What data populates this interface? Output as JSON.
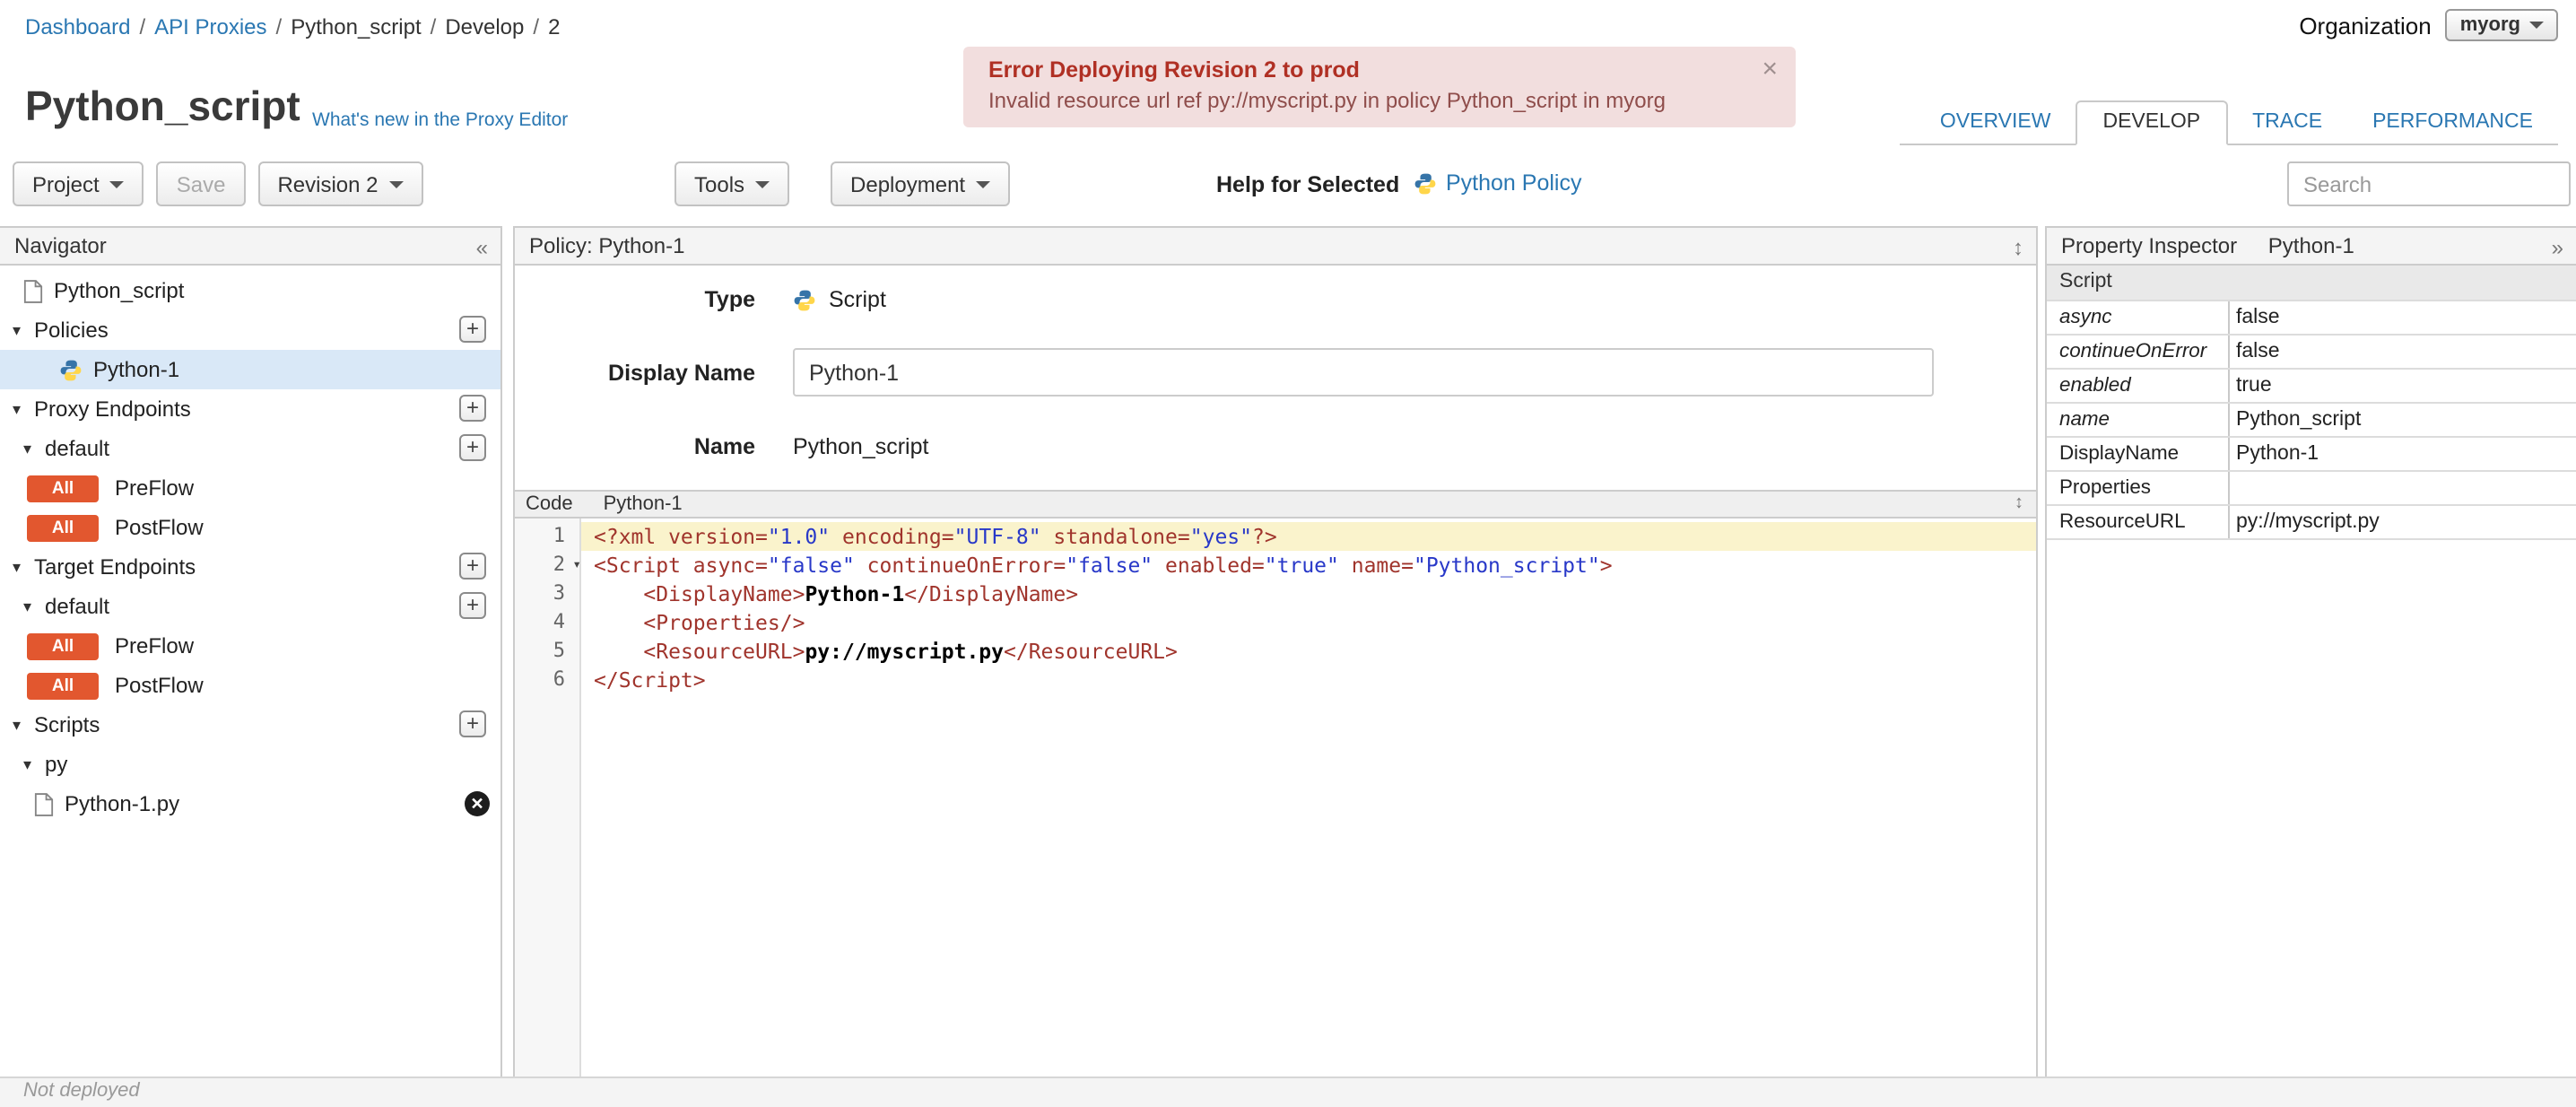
{
  "page": {
    "breadcrumb": [
      {
        "label": "Dashboard",
        "link": true
      },
      {
        "label": "API Proxies",
        "link": true
      },
      {
        "label": "Python_script",
        "link": false
      },
      {
        "label": "Develop",
        "link": false
      },
      {
        "label": "2",
        "link": false
      }
    ],
    "organization": {
      "label": "Organization",
      "value": "myorg"
    },
    "error_banner": {
      "title": "Error Deploying Revision 2 to prod",
      "message": "Invalid resource url ref py://myscript.py in policy Python_script in myorg",
      "close_label": "×"
    },
    "title": "Python_script",
    "whats_new_link": "What's new in the Proxy Editor",
    "tabs": [
      {
        "label": "OVERVIEW",
        "active": false
      },
      {
        "label": "DEVELOP",
        "active": true
      },
      {
        "label": "TRACE",
        "active": false
      },
      {
        "label": "PERFORMANCE",
        "active": false
      }
    ],
    "toolbar": {
      "project_button": "Project",
      "save_button": "Save",
      "revision_button": "Revision 2",
      "tools_button": "Tools",
      "deployment_button": "Deployment",
      "help_for_selected": "Help for Selected",
      "policy_help_link": "Python Policy",
      "search_placeholder": "Search"
    },
    "status_bar": "Not deployed"
  },
  "navigator": {
    "title": "Navigator",
    "items": [
      {
        "kind": "root",
        "icon": "file",
        "label": "Python_script"
      },
      {
        "kind": "section",
        "label": "Policies",
        "plus": true
      },
      {
        "kind": "policy",
        "icon": "python",
        "label": "Python-1",
        "selected": true
      },
      {
        "kind": "section",
        "label": "Proxy Endpoints",
        "plus": true
      },
      {
        "kind": "subsection",
        "label": "default",
        "plus": true
      },
      {
        "kind": "flow",
        "badge": "All",
        "label": "PreFlow"
      },
      {
        "kind": "flow",
        "badge": "All",
        "label": "PostFlow"
      },
      {
        "kind": "section",
        "label": "Target Endpoints",
        "plus": true
      },
      {
        "kind": "subsection",
        "label": "default",
        "plus": true
      },
      {
        "kind": "flow",
        "badge": "All",
        "label": "PreFlow"
      },
      {
        "kind": "flow",
        "badge": "All",
        "label": "PostFlow"
      },
      {
        "kind": "section",
        "label": "Scripts",
        "plus": true
      },
      {
        "kind": "subsection",
        "label": "py"
      },
      {
        "kind": "scriptfile",
        "icon": "file",
        "label": "Python-1.py",
        "deletable": true
      }
    ]
  },
  "policy_panel": {
    "header": "Policy: Python-1",
    "type_label": "Type",
    "type_value": "Script",
    "display_name_label": "Display Name",
    "display_name_value": "Python-1",
    "name_label": "Name",
    "name_value": "Python_script"
  },
  "code_panel": {
    "header_label": "Code",
    "header_value": "Python-1",
    "lines": [
      {
        "n": 1,
        "highlight": true,
        "tokens": [
          [
            "tag",
            "<?xml version="
          ],
          [
            "str",
            "\"1.0\""
          ],
          [
            "tag",
            " encoding="
          ],
          [
            "str",
            "\"UTF-8\""
          ],
          [
            "tag",
            " standalone="
          ],
          [
            "str",
            "\"yes\""
          ],
          [
            "tag",
            "?>"
          ]
        ]
      },
      {
        "n": 2,
        "fold": true,
        "tokens": [
          [
            "tag",
            "<Script async="
          ],
          [
            "str",
            "\"false\""
          ],
          [
            "tag",
            " continueOnError="
          ],
          [
            "str",
            "\"false\""
          ],
          [
            "tag",
            " enabled="
          ],
          [
            "str",
            "\"true\""
          ],
          [
            "tag",
            " name="
          ],
          [
            "str",
            "\"Python_script\""
          ],
          [
            "tag",
            ">"
          ]
        ]
      },
      {
        "n": 3,
        "tokens": [
          [
            "plain",
            "    "
          ],
          [
            "tag",
            "<DisplayName>"
          ],
          [
            "text",
            "Python-1"
          ],
          [
            "tag",
            "</DisplayName>"
          ]
        ]
      },
      {
        "n": 4,
        "tokens": [
          [
            "plain",
            "    "
          ],
          [
            "tag",
            "<Properties/>"
          ]
        ]
      },
      {
        "n": 5,
        "tokens": [
          [
            "plain",
            "    "
          ],
          [
            "tag",
            "<ResourceURL>"
          ],
          [
            "text",
            "py://myscript.py"
          ],
          [
            "tag",
            "</ResourceURL>"
          ]
        ]
      },
      {
        "n": 6,
        "tokens": [
          [
            "tag",
            "</Script>"
          ]
        ]
      }
    ]
  },
  "property_inspector": {
    "title": "Property Inspector",
    "subtitle": "Python-1",
    "section_header": "Script",
    "rows": [
      {
        "name": "async",
        "value": "false",
        "italic": true
      },
      {
        "name": "continueOnError",
        "value": "false",
        "italic": true
      },
      {
        "name": "enabled",
        "value": "true",
        "italic": true
      },
      {
        "name": "name",
        "value": "Python_script",
        "italic": true
      },
      {
        "name": "DisplayName",
        "value": "Python-1",
        "italic": false
      },
      {
        "name": "Properties",
        "value": "",
        "italic": false
      },
      {
        "name": "ResourceURL",
        "value": "py://myscript.py",
        "italic": false
      }
    ]
  }
}
